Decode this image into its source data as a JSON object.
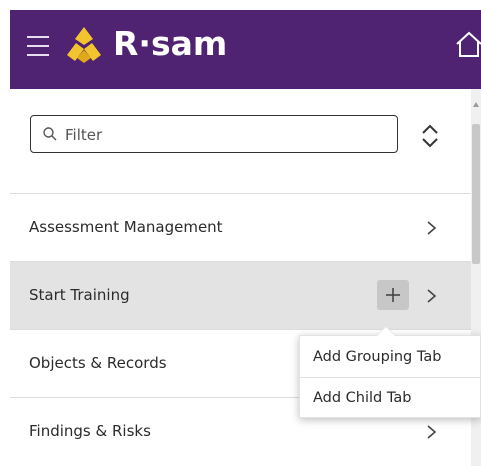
{
  "header": {
    "brand_name": "R·sam",
    "menu_icon": "hamburger-icon",
    "logo_icon": "rsam-logo-icon",
    "home_icon": "home-icon",
    "background_color": "#4f2272",
    "logo_color": "#f2c52e"
  },
  "sidebar": {
    "filter_placeholder": "Filter",
    "filter_value": "",
    "filter_icon": "search-icon",
    "sort_icon": "sort-toggle-icon",
    "items": [
      {
        "label": "Assessment Management",
        "has_chevron": true,
        "active": false
      },
      {
        "label": "Start Training",
        "has_chevron": true,
        "has_add_button": true,
        "active": true
      },
      {
        "label": "Objects & Records",
        "has_chevron": false,
        "active": false
      },
      {
        "label": "Findings & Risks",
        "has_chevron": true,
        "active": false
      }
    ]
  },
  "popup_menu": {
    "items": [
      {
        "label": "Add Grouping Tab"
      },
      {
        "label": "Add Child Tab"
      }
    ]
  }
}
